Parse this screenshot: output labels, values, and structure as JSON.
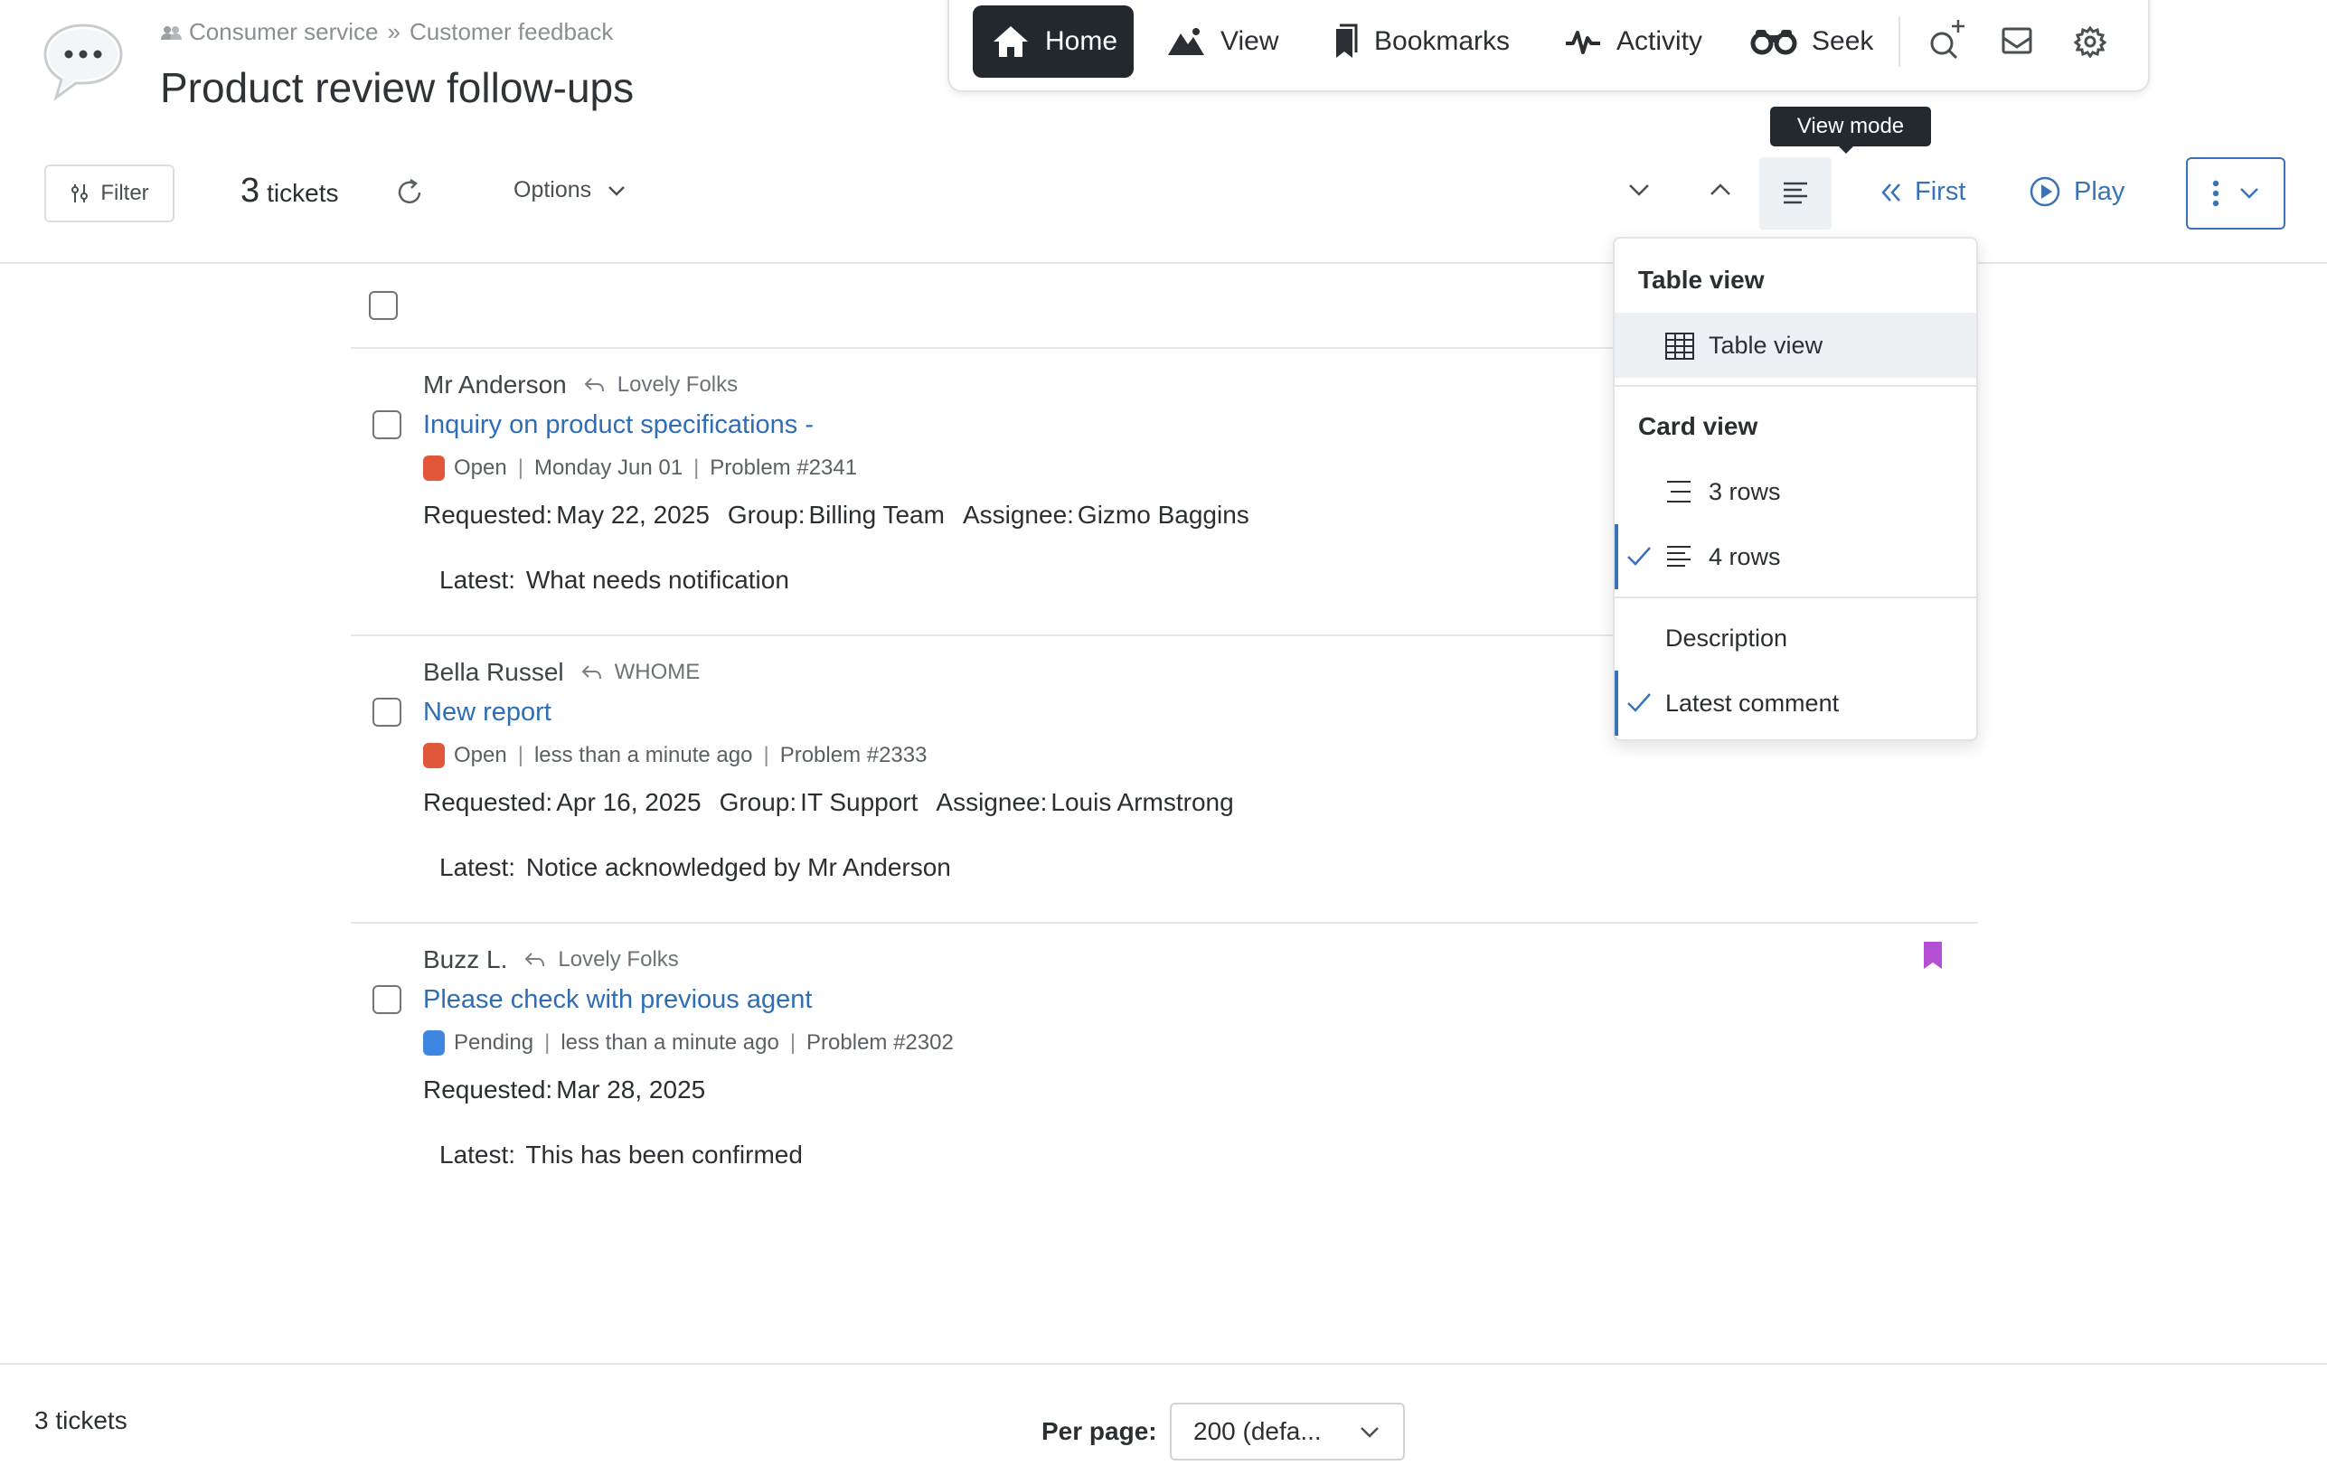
{
  "header": {
    "breadcrumb": [
      "Consumer service",
      "Customer feedback"
    ],
    "breadcrumb_separator": "»",
    "title": "Product review follow-ups"
  },
  "nav": {
    "items": [
      {
        "label": "Home",
        "icon": "home-icon",
        "active": true
      },
      {
        "label": "View",
        "icon": "mountain-icon"
      },
      {
        "label": "Bookmarks",
        "icon": "bookmark-icon"
      },
      {
        "label": "Activity",
        "icon": "pulse-icon"
      },
      {
        "label": "Seek",
        "icon": "binoculars-icon"
      }
    ],
    "utility_icons": [
      "search-plus-icon",
      "inbox-icon",
      "gear-icon"
    ]
  },
  "toolbar": {
    "filter_label": "Filter",
    "ticket_count": "3",
    "ticket_count_label": "tickets",
    "options_label": "Options",
    "view_mode_tooltip": "View mode",
    "first_label": "First",
    "play_label": "Play"
  },
  "view_menu": {
    "table_header": "Table view",
    "table_item": "Table view",
    "card_header": "Card view",
    "card_items": [
      {
        "label": "3 rows",
        "checked": false
      },
      {
        "label": "4 rows",
        "checked": true
      }
    ],
    "extra_items": [
      {
        "label": "Description",
        "checked": false
      },
      {
        "label": "Latest comment",
        "checked": true
      }
    ]
  },
  "tickets": [
    {
      "requester": "Mr Anderson",
      "organization": "Lovely Folks",
      "subject": "Inquiry on product specifications -",
      "status": "Open",
      "status_color": "#e0573a",
      "updated": "Monday Jun 01",
      "ticket_ref": "Problem #2341",
      "requested_label": "Requested:",
      "requested": "May 22, 2025",
      "group_label": "Group:",
      "group": "Billing Team",
      "assignee_label": "Assignee:",
      "assignee": "Gizmo Baggins",
      "latest_label": "Latest:",
      "latest": "What needs notification",
      "bookmarked": false
    },
    {
      "requester": "Bella Russel",
      "organization": "WHOME",
      "subject": "New report",
      "status": "Open",
      "status_color": "#e0573a",
      "updated": "less than a minute ago",
      "ticket_ref": "Problem #2333",
      "requested_label": "Requested:",
      "requested": "Apr 16, 2025",
      "group_label": "Group:",
      "group": "IT Support",
      "assignee_label": "Assignee:",
      "assignee": "Louis Armstrong",
      "latest_label": "Latest:",
      "latest": "Notice acknowledged by Mr Anderson",
      "bookmarked": false
    },
    {
      "requester": "Buzz L.",
      "organization": "Lovely Folks",
      "subject": "Please check with previous agent",
      "status": "Pending",
      "status_color": "#3e86e0",
      "updated": "less than a minute ago",
      "ticket_ref": "Problem #2302",
      "requested_label": "Requested:",
      "requested": "Mar 28, 2025",
      "latest_label": "Latest:",
      "latest": "This has been confirmed",
      "bookmarked": true,
      "bookmark_color": "#b44fd6"
    }
  ],
  "footer": {
    "ticket_count": "3 tickets",
    "per_page_label": "Per page:",
    "per_page_value": "200 (defa..."
  },
  "colors": {
    "accent": "#3a72b8",
    "nav_active_bg": "#22282e"
  }
}
